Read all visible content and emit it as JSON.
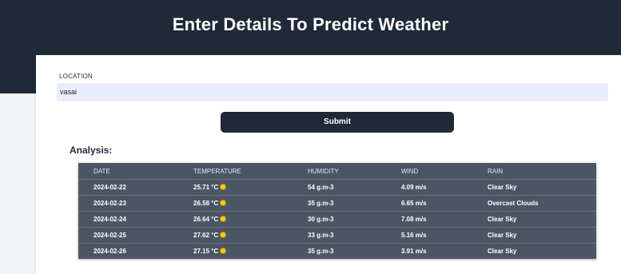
{
  "header": {
    "title": "Enter Details To Predict Weather"
  },
  "form": {
    "location_label": "LOCATION",
    "location_value": "vasai",
    "submit_label": "Submit"
  },
  "analysis": {
    "title": "Analysis:",
    "columns": [
      "DATE",
      "TEMPERATURE",
      "HUMIDITY",
      "WIND",
      "RAIN"
    ],
    "rows": [
      {
        "date": "2024-02-22",
        "temperature": "25.71 °C",
        "temp_icon": "sun-icon",
        "humidity": "54 g.m-3",
        "wind": "4.09 m/s",
        "rain": "Clear Sky"
      },
      {
        "date": "2024-02-23",
        "temperature": "26.58 °C",
        "temp_icon": "sun-icon",
        "humidity": "35 g.m-3",
        "wind": "6.65 m/s",
        "rain": "Overcast Clouds"
      },
      {
        "date": "2024-02-24",
        "temperature": "26.64 °C",
        "temp_icon": "sun-icon",
        "humidity": "30 g.m-3",
        "wind": "7.08 m/s",
        "rain": "Clear Sky"
      },
      {
        "date": "2024-02-25",
        "temperature": "27.62 °C",
        "temp_icon": "sun-icon",
        "humidity": "33 g.m-3",
        "wind": "5.16 m/s",
        "rain": "Clear Sky"
      },
      {
        "date": "2024-02-26",
        "temperature": "27.15 °C",
        "temp_icon": "sun-icon",
        "humidity": "35 g.m-3",
        "wind": "3.91 m/s",
        "rain": "Clear Sky"
      }
    ]
  },
  "colors": {
    "header_bg": "#1f2937",
    "table_bg": "#4b5563",
    "input_bg": "#e8eefc",
    "sun": "#facc15"
  }
}
